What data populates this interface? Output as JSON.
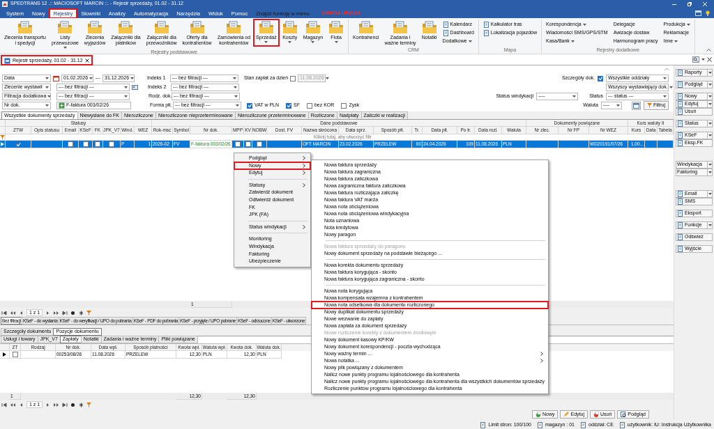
{
  "window": {
    "title": "SPEDTRANS 12 .:: MACIOSOFT MARCIN ::. - Rejestr sprzedaży, 01.02 - 31.12"
  },
  "menu": [
    {
      "label": "System",
      "selected": false,
      "annotated": false
    },
    {
      "label": "Nowy",
      "selected": false,
      "annotated": false
    },
    {
      "label": "Rejestry",
      "selected": true,
      "annotated": true
    },
    {
      "label": "Słowniki",
      "selected": false,
      "annotated": false
    },
    {
      "label": "Analizy",
      "selected": false,
      "annotated": false
    },
    {
      "label": "Automatyzacja",
      "selected": false,
      "annotated": false
    },
    {
      "label": "Narzędzia",
      "selected": false,
      "annotated": false
    },
    {
      "label": "Widok",
      "selected": false,
      "annotated": false
    },
    {
      "label": "Pomoc",
      "selected": false,
      "annotated": false
    }
  ],
  "menu_search": {
    "placeholder": "Znajdź funkcję w menu"
  },
  "menu_alert": "UWAGA UWAGA",
  "ribbon": [
    {
      "label": "Rejestry podstawowe",
      "items": [
        {
          "label": "Zlecenia transportu\ni spedycji",
          "kind": "large",
          "dropdown": false,
          "annotated": false
        },
        {
          "label": "Listy\nprzewozowe",
          "kind": "large",
          "dropdown": true,
          "annotated": false
        },
        {
          "label": "Zlecenia\nwyjazdów",
          "kind": "large",
          "dropdown": false,
          "annotated": false
        },
        {
          "label": "Załączniki dla\npłatników",
          "kind": "large",
          "dropdown": false,
          "annotated": false
        },
        {
          "label": "Załączniki dla\nprzewoźników",
          "kind": "large",
          "dropdown": false,
          "annotated": false
        },
        {
          "label": "Oferty dla\nkontrahentów",
          "kind": "large",
          "dropdown": false,
          "annotated": false
        },
        {
          "label": "Zamówienia od\nkontrahentów",
          "kind": "large",
          "dropdown": false,
          "annotated": false
        },
        {
          "label": "Sprzedaż",
          "kind": "large",
          "dropdown": true,
          "annotated": true
        },
        {
          "label": "Koszty",
          "kind": "large",
          "dropdown": true,
          "annotated": false
        },
        {
          "label": "Magazyn",
          "kind": "large",
          "dropdown": true,
          "annotated": false
        },
        {
          "label": "Flota",
          "kind": "large",
          "dropdown": true,
          "annotated": false
        }
      ]
    },
    {
      "label": "CRM",
      "items": [
        {
          "label": "Kontrahenci",
          "kind": "large",
          "dropdown": false,
          "annotated": false
        },
        {
          "label": "Zadania i\nważne terminy",
          "kind": "large",
          "dropdown": false,
          "annotated": false
        },
        {
          "label": "Notatki",
          "kind": "large",
          "dropdown": false,
          "annotated": false
        },
        {
          "label": "Kalendarz",
          "kind": "small",
          "dropdown": false,
          "annotated": false
        },
        {
          "label": "Dashboard",
          "kind": "small",
          "dropdown": false,
          "annotated": false
        },
        {
          "label": "Dodatkowe",
          "kind": "text",
          "dropdown": true,
          "annotated": false
        }
      ]
    },
    {
      "label": "Mapa",
      "items": [
        {
          "label": "Kalkulator tras",
          "kind": "small",
          "dropdown": false,
          "annotated": false
        },
        {
          "label": "Lokalizacja pojazdów",
          "kind": "small",
          "dropdown": false,
          "annotated": false
        }
      ]
    },
    {
      "label": "Rejestry dodatkowe",
      "items": [
        {
          "label": "Korespondencja",
          "kind": "text",
          "dropdown": true,
          "annotated": false
        },
        {
          "label": "Wiadomości SMS/GPS/STM",
          "kind": "text",
          "dropdown": false,
          "annotated": false
        },
        {
          "label": "Kasa/Bank",
          "kind": "text",
          "dropdown": true,
          "annotated": false
        },
        {
          "label": "Delegacje",
          "kind": "text",
          "dropdown": false,
          "annotated": false
        },
        {
          "label": "Awizacje dostaw",
          "kind": "text",
          "dropdown": false,
          "annotated": false
        },
        {
          "label": "Harmonogram pracy",
          "kind": "text",
          "dropdown": false,
          "annotated": false
        },
        {
          "label": "Produkcja",
          "kind": "text",
          "dropdown": true,
          "annotated": false
        },
        {
          "label": "Reklamacje",
          "kind": "text",
          "dropdown": false,
          "annotated": false
        },
        {
          "label": "Inne",
          "kind": "text",
          "dropdown": true,
          "annotated": false
        }
      ]
    }
  ],
  "document_tab": {
    "label": "Rejestr sprzedaży, 01.02 - 31.12",
    "annotated": true
  },
  "filters": {
    "left": [
      {
        "kind": "daterange",
        "field": "Data",
        "from": "01.02.2026",
        "separator": "---",
        "to": "31.12.2026"
      },
      {
        "kind": "select",
        "field": "Zlecenie wystawił",
        "value": "--- bez filtracji ---"
      },
      {
        "kind": "select",
        "field": "Filtracja dodatkowa",
        "value": "--- bez filtracji ---"
      },
      {
        "kind": "document",
        "field": "Nr dok.",
        "value": "F-faktura 003/02/26"
      }
    ],
    "middle": [
      {
        "label": "Indeks 1",
        "value": "--- bez filtracji ---"
      },
      {
        "label": "Indeks 2",
        "value": "--- bez filtracji ---"
      },
      {
        "label": "Rodz. dok.",
        "value": "--- bez filtracji ---"
      },
      {
        "label": "Forma płt.",
        "value": "--- bez filtracji ---"
      }
    ],
    "payment_state": {
      "label": "Stan zapłat za dzień",
      "checked": false,
      "date": "11.08.2026"
    },
    "options": [
      {
        "label": "VAT w PLN",
        "checked": true
      },
      {
        "label": "SF",
        "checked": true
      },
      {
        "label": "bez KOR",
        "checked": false
      },
      {
        "label": "Zysk",
        "checked": false
      }
    ],
    "details": {
      "label": "Szczegóły dok.",
      "checked": true
    },
    "branch": "Wszystkie oddziały",
    "issuer": "Wszyscy wystawiający dok.",
    "collection_status": {
      "label": "Status windykacji",
      "value": "----"
    },
    "status": {
      "label": "Status",
      "value": "--- status ---"
    },
    "currency": {
      "label": "Waluta",
      "value": "----"
    },
    "filter_button": "Filtruj"
  },
  "grid": {
    "tabs": [
      {
        "label": "Wszystkie dokumenty sprzedaży",
        "selected": true
      },
      {
        "label": "Niewysłane do FK",
        "selected": false
      },
      {
        "label": "Nierozliczone",
        "selected": false
      },
      {
        "label": "Nierozliczone nieprzeterminowane",
        "selected": false
      },
      {
        "label": "Nierozliczone przeterminowane",
        "selected": false
      },
      {
        "label": "Rozliczone",
        "selected": false
      },
      {
        "label": "Nadpłaty",
        "selected": false
      },
      {
        "label": "Zaliczki w realizacji",
        "selected": false
      }
    ],
    "column_groups": [
      {
        "label": "Statusy",
        "columns": [
          {
            "label": "ZTW"
          },
          {
            "label": "Opis statusu"
          },
          {
            "label": "Email"
          },
          {
            "label": "KSeF"
          },
          {
            "label": "FK"
          },
          {
            "label": "JPK_V7"
          },
          {
            "label": "Wind."
          },
          {
            "label": "WEZ"
          }
        ]
      },
      {
        "label": "Dane podstawowe",
        "columns": [
          {
            "label": "Rok-msc"
          },
          {
            "label": "Symbol"
          },
          {
            "label": "Nr dok.",
            "total": "1"
          },
          {
            "label": "MPP"
          },
          {
            "label": "KV"
          },
          {
            "label": "NOBW"
          },
          {
            "label": "Dost. FV"
          },
          {
            "label": "Nazwa skrócona"
          },
          {
            "label": "Data sprz."
          },
          {
            "label": "Sposób płt."
          },
          {
            "label": "Tr."
          },
          {
            "label": "Data płt."
          },
          {
            "label": "Po tr."
          },
          {
            "label": "Data rozl."
          },
          {
            "label": "Waluta"
          }
        ]
      },
      {
        "label": "Dokumenty powiązane",
        "columns": [
          {
            "label": "Nr zlec."
          },
          {
            "label": "Nr FP"
          },
          {
            "label": "Nr WEZ"
          }
        ]
      },
      {
        "label": "Kurs waluty II",
        "columns": [
          {
            "label": "Kurs"
          },
          {
            "label": "Data"
          },
          {
            "label": "Tabela"
          }
        ]
      }
    ],
    "filter_hint": "Kliknij tutaj, aby utworzyć filtr",
    "rows": [
      {
        "selected": true,
        "cells": [
          {
            "kind": "check",
            "checked": true
          },
          {
            "kind": "empty"
          },
          {
            "kind": "check",
            "checked": false
          },
          {
            "kind": "check",
            "checked": false
          },
          {
            "kind": "check",
            "checked": false
          },
          {
            "kind": "check",
            "checked": false
          },
          {
            "kind": "text",
            "text": "P",
            "focused": false
          },
          {
            "kind": "text",
            "text": "1",
            "focused": false
          },
          {
            "kind": "text",
            "text": "2026-02",
            "focused": false
          },
          {
            "kind": "text",
            "text": "FV",
            "focused": false
          },
          {
            "kind": "text",
            "text": "F-faktura 003/02/26",
            "focused": true
          },
          {
            "kind": "check",
            "checked": false
          },
          {
            "kind": "check",
            "checked": false
          },
          {
            "kind": "check",
            "checked": false
          },
          {
            "kind": "empty"
          },
          {
            "kind": "text",
            "text": "OFT MARCIN",
            "focused": false
          },
          {
            "kind": "text",
            "text": "23.02.2026",
            "focused": false
          },
          {
            "kind": "text",
            "text": "PRZELEW",
            "focused": false
          },
          {
            "kind": "text",
            "text": "60",
            "focused": false
          },
          {
            "kind": "text",
            "text": "24.04.2026",
            "focused": false
          },
          {
            "kind": "text",
            "text": "109",
            "focused": false
          },
          {
            "kind": "text",
            "text": "11.08.2026",
            "focused": false
          },
          {
            "kind": "text",
            "text": "PLN",
            "focused": false
          },
          {
            "kind": "empty"
          },
          {
            "kind": "empty"
          },
          {
            "kind": "text",
            "text": "WD20191/07/26",
            "focused": false
          },
          {
            "kind": "text",
            "text": "1,00...",
            "focused": false
          },
          {
            "kind": "empty"
          },
          {
            "kind": "empty"
          }
        ]
      }
    ],
    "pager": "1 z 1"
  },
  "ksef_tabs": [
    {
      "label": "Bez filtracji",
      "selected": true
    },
    {
      "label": "KSeF - do wysłania",
      "selected": false
    },
    {
      "label": "KSeF - do weryfikacji / UPO do pobrania",
      "selected": false
    },
    {
      "label": "KSeF - PDF do pobrania",
      "selected": false
    },
    {
      "label": "KSeF - przyjęte / UPO pobrane",
      "selected": false
    },
    {
      "label": "KSeF - odrzucone",
      "selected": false
    },
    {
      "label": "KSeF - utworzone",
      "selected": false
    }
  ],
  "detail_tabs": [
    {
      "label": "Szczegóły dokumentu",
      "selected": false
    },
    {
      "label": "Pozycje dokumentu",
      "selected": true
    }
  ],
  "detail_subtabs": [
    {
      "label": "Usługi i towary",
      "selected": false
    },
    {
      "label": "JPK_V7",
      "selected": false
    },
    {
      "label": "Zapłaty",
      "selected": true
    },
    {
      "label": "Notatki",
      "selected": false
    },
    {
      "label": "Zadania i ważne terminy",
      "selected": false
    },
    {
      "label": "Pliki powiązane",
      "selected": false
    }
  ],
  "payments": {
    "columns": [
      {
        "label": "ZT",
        "total": "1"
      },
      {
        "label": "Rodzaj"
      },
      {
        "label": "Nr dok."
      },
      {
        "label": "Data wpł."
      },
      {
        "label": "Sposób płatności"
      },
      {
        "label": "Kwota wpł.",
        "total": "12,30"
      },
      {
        "label": "Waluta wpł."
      },
      {
        "label": "Kwota dok.",
        "total": "12,30"
      },
      {
        "label": "Waluta dok."
      }
    ],
    "rows": [
      {
        "selected": false,
        "cells": [
          {
            "kind": "check",
            "checked": false
          },
          {
            "kind": "empty"
          },
          {
            "kind": "text",
            "text": "00253/08/26",
            "focused": false
          },
          {
            "kind": "text",
            "text": "11.08.2026",
            "focused": false
          },
          {
            "kind": "text",
            "text": "PRZELEW",
            "focused": false
          },
          {
            "kind": "text",
            "text": "12,30",
            "focused": false
          },
          {
            "kind": "text",
            "text": "PLN",
            "focused": false
          },
          {
            "kind": "text",
            "text": "12,30",
            "focused": false
          },
          {
            "kind": "text",
            "text": "PLN",
            "focused": false
          }
        ]
      }
    ],
    "pager": "1 z 1"
  },
  "bottom_buttons": [
    "Nowy",
    "Edytuj",
    "Usuń",
    "Podgląd"
  ],
  "side_buttons": [
    [
      {
        "label": "Raporty",
        "dropdown": true,
        "icon": true
      }
    ],
    [
      {
        "label": "Podgląd",
        "dropdown": true,
        "icon": true
      }
    ],
    [
      {
        "label": "Nowy",
        "dropdown": true,
        "icon": true
      },
      {
        "label": "Edytuj",
        "dropdown": true,
        "icon": true
      },
      {
        "label": "Usuń",
        "dropdown": false,
        "icon": true
      }
    ],
    [
      {
        "label": "Status",
        "dropdown": true,
        "icon": true
      }
    ],
    [
      {
        "label": "KSeF",
        "dropdown": true,
        "icon": true
      },
      {
        "label": "Eksp.FK",
        "dropdown": false,
        "icon": true
      }
    ],
    [
      {
        "label": "Windykacja",
        "dropdown": true,
        "icon": false
      },
      {
        "label": "Faktoring",
        "dropdown": true,
        "icon": false
      }
    ],
    [
      {
        "label": "Email",
        "dropdown": true,
        "icon": true
      },
      {
        "label": "SMS",
        "dropdown": false,
        "icon": true
      }
    ],
    [
      {
        "label": "Eksport",
        "dropdown": false,
        "icon": true
      }
    ],
    [
      {
        "label": "Funkcje",
        "dropdown": true,
        "icon": true
      }
    ],
    [
      {
        "label": "Odśwież",
        "dropdown": false,
        "icon": true
      }
    ],
    [
      {
        "label": "Wyjście",
        "dropdown": false,
        "icon": true
      }
    ]
  ],
  "context_menu": [
    {
      "kind": "item",
      "label": "Podgląd",
      "submenu": true,
      "annotated": false
    },
    {
      "kind": "item",
      "label": "Nowy",
      "submenu": true,
      "annotated": true
    },
    {
      "kind": "item",
      "label": "Edytuj",
      "submenu": true,
      "annotated": false
    },
    {
      "kind": "separator"
    },
    {
      "kind": "item",
      "label": "Statusy",
      "submenu": true,
      "annotated": false
    },
    {
      "kind": "item",
      "label": "Zatwierdź dokument",
      "submenu": false,
      "annotated": false
    },
    {
      "kind": "item",
      "label": "Odtwierdź dokument",
      "submenu": false,
      "annotated": false
    },
    {
      "kind": "item",
      "label": "FK",
      "submenu": false,
      "annotated": false
    },
    {
      "kind": "item",
      "label": "JPK (FA)",
      "submenu": false,
      "annotated": false
    },
    {
      "kind": "separator"
    },
    {
      "kind": "item",
      "label": "Status windykacji",
      "submenu": true,
      "annotated": false
    },
    {
      "kind": "separator"
    },
    {
      "kind": "item",
      "label": "Monitoring",
      "submenu": false,
      "annotated": false
    },
    {
      "kind": "item",
      "label": "Windykacja",
      "submenu": false,
      "annotated": false
    },
    {
      "kind": "item",
      "label": "Faktoring",
      "submenu": false,
      "annotated": false
    },
    {
      "kind": "item",
      "label": "Ubezpieczenie",
      "submenu": false,
      "annotated": false
    }
  ],
  "submenu": [
    {
      "kind": "item",
      "label": "Nowa faktura sprzedaży",
      "disabled": false,
      "submenu": false,
      "annotated": false
    },
    {
      "kind": "item",
      "label": "Nowa faktura zagraniczna",
      "disabled": false,
      "submenu": false,
      "annotated": false
    },
    {
      "kind": "item",
      "label": "Nowa faktura zaliczkowa",
      "disabled": false,
      "submenu": false,
      "annotated": false
    },
    {
      "kind": "item",
      "label": "Nowa zagraniczna faktura zaliczkowa",
      "disabled": false,
      "submenu": false,
      "annotated": false
    },
    {
      "kind": "item",
      "label": "Nowa faktura rozliczająca zaliczkę",
      "disabled": false,
      "submenu": false,
      "annotated": false
    },
    {
      "kind": "item",
      "label": "Nowa faktura VAT marża",
      "disabled": false,
      "submenu": false,
      "annotated": false
    },
    {
      "kind": "item",
      "label": "Nowa nota obciążeniowa",
      "disabled": false,
      "submenu": false,
      "annotated": false
    },
    {
      "kind": "item",
      "label": "Nowa nota obciążeniowa windykacyjna",
      "disabled": false,
      "submenu": false,
      "annotated": false
    },
    {
      "kind": "item",
      "label": "Nota uznaniowa",
      "disabled": false,
      "submenu": false,
      "annotated": false
    },
    {
      "kind": "item",
      "label": "Nota kredytowa",
      "disabled": false,
      "submenu": false,
      "annotated": false
    },
    {
      "kind": "item",
      "label": "Nowy paragon",
      "disabled": false,
      "submenu": false,
      "annotated": false
    },
    {
      "kind": "separator"
    },
    {
      "kind": "item",
      "label": "Nowa faktura sprzedaży do paragonu",
      "disabled": true,
      "submenu": false,
      "annotated": false
    },
    {
      "kind": "item",
      "label": "Nowy dokument sprzedaży na podstawie bieżącego ...",
      "disabled": false,
      "submenu": false,
      "annotated": false
    },
    {
      "kind": "separator"
    },
    {
      "kind": "item",
      "label": "Nowa korekta dokumentu sprzedaży",
      "disabled": false,
      "submenu": false,
      "annotated": false
    },
    {
      "kind": "item",
      "label": "Nowa faktura korygująca - skonto",
      "disabled": false,
      "submenu": false,
      "annotated": false
    },
    {
      "kind": "item",
      "label": "Nowa faktura korygująca zagraniczna - skonto",
      "disabled": false,
      "submenu": false,
      "annotated": false
    },
    {
      "kind": "separator"
    },
    {
      "kind": "item",
      "label": "Nowa nota korygująca",
      "disabled": false,
      "submenu": false,
      "annotated": false
    },
    {
      "kind": "item",
      "label": "Nowa kompensata wzajemna z kontrahentem",
      "disabled": false,
      "submenu": false,
      "annotated": false
    },
    {
      "kind": "item",
      "label": "Nowa nota odsetkowa dla dokumentu rozliczonego",
      "disabled": false,
      "submenu": false,
      "annotated": true
    },
    {
      "kind": "item",
      "label": "Nowy duplikat dokumentu sprzedaży",
      "disabled": false,
      "submenu": false,
      "annotated": false
    },
    {
      "kind": "item",
      "label": "Nowe wezwanie do zapłaty",
      "disabled": false,
      "submenu": false,
      "annotated": false
    },
    {
      "kind": "item",
      "label": "Nowa zapłata za dokument sprzedaży",
      "disabled": false,
      "submenu": false,
      "annotated": false
    },
    {
      "kind": "item",
      "label": "Nowe rozliczenie korekty z dokumentem źródłowym",
      "disabled": true,
      "submenu": false,
      "annotated": false
    },
    {
      "kind": "item",
      "label": "Nowy dokument kasowy KP/KW",
      "disabled": false,
      "submenu": false,
      "annotated": false
    },
    {
      "kind": "item",
      "label": "Nowy dokument korespondencji - poczta wychodząca",
      "disabled": false,
      "submenu": false,
      "annotated": false
    },
    {
      "kind": "item",
      "label": "Nowy ważny termin ...",
      "disabled": false,
      "submenu": true,
      "annotated": false
    },
    {
      "kind": "item",
      "label": "Nowa notatka ...",
      "disabled": false,
      "submenu": true,
      "annotated": false
    },
    {
      "kind": "item",
      "label": "Nowy plik powiązany z dokumentem",
      "disabled": false,
      "submenu": false,
      "annotated": false
    },
    {
      "kind": "item",
      "label": "Nalicz nowe punkty programu lojalnościowego dla kontrahenta",
      "disabled": false,
      "submenu": false,
      "annotated": false
    },
    {
      "kind": "item",
      "label": "Nalicz nowe punkty programu lojalnościowego dla kontrahenta dla wszystkich dokumentów sprzedaży",
      "disabled": false,
      "submenu": false,
      "annotated": false
    },
    {
      "kind": "item",
      "label": "Rozliczenie punktów programu lojalnościowego dla kontrahenta",
      "disabled": false,
      "submenu": false,
      "annotated": false
    }
  ],
  "status_bar": [
    "Limit stron: 100/100",
    "magazyn : 01",
    "oddział: CE",
    "użytkownik: IU: Instrukcja Użytkownika"
  ]
}
